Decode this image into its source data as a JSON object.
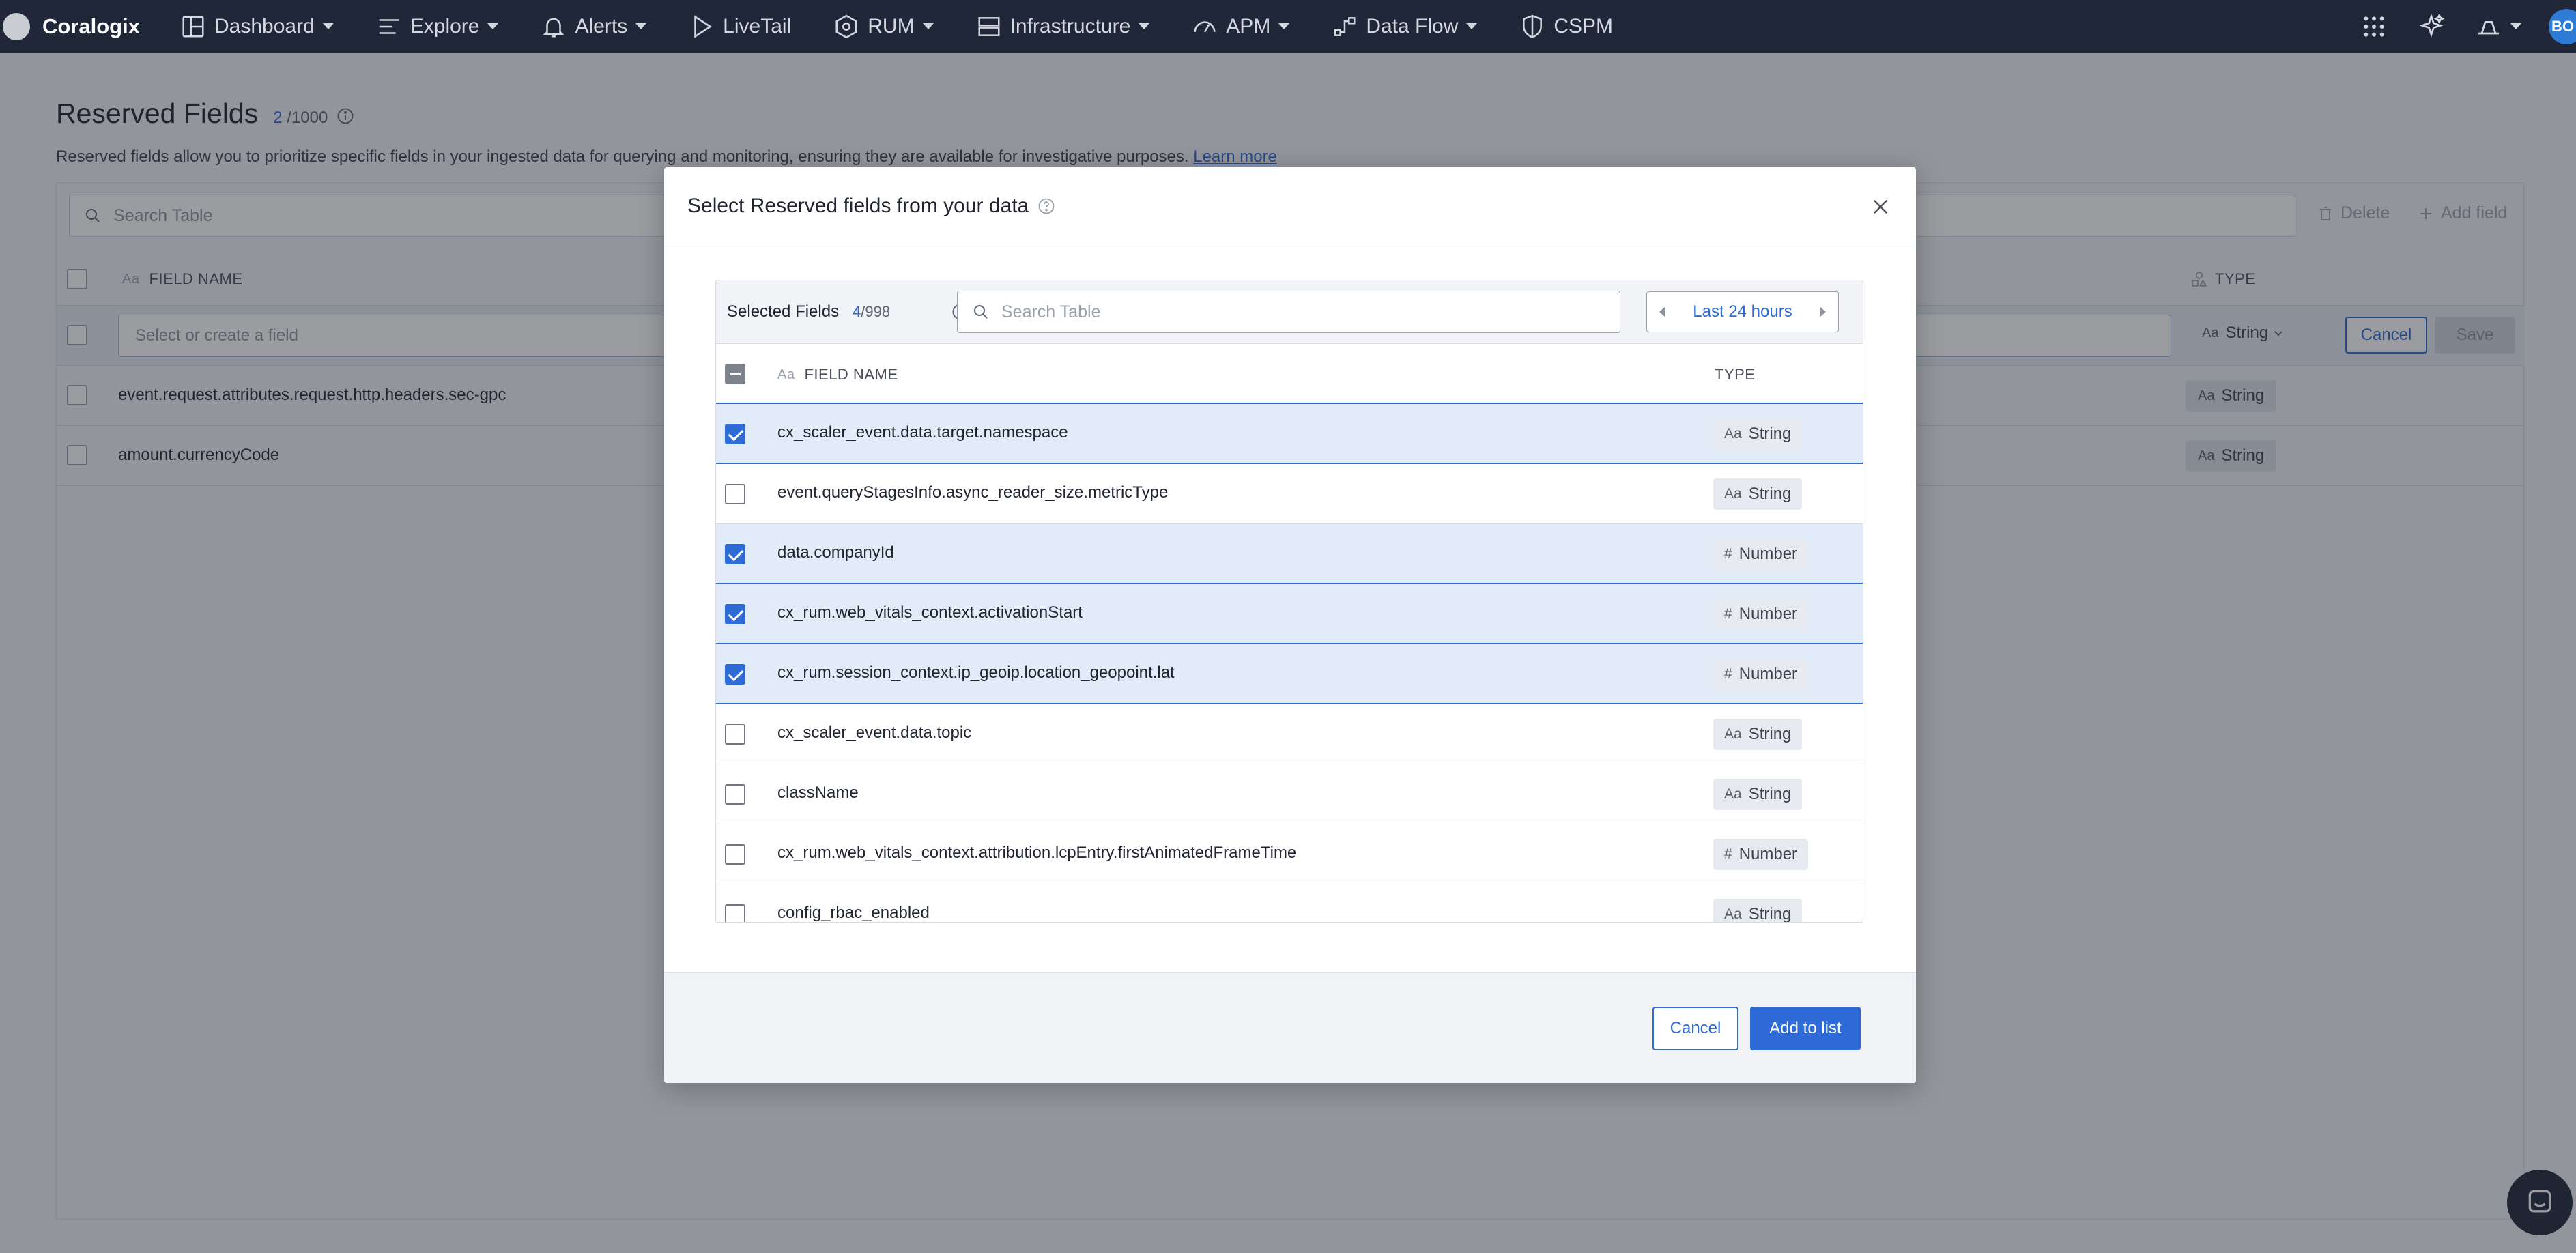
{
  "brand": {
    "name": "Coralogix"
  },
  "nav": {
    "items": [
      {
        "label": "Dashboard",
        "icon": "dashboard-icon",
        "has_caret": true
      },
      {
        "label": "Explore",
        "icon": "explore-icon",
        "has_caret": true
      },
      {
        "label": "Alerts",
        "icon": "bell-icon",
        "has_caret": true
      },
      {
        "label": "LiveTail",
        "icon": "play-icon",
        "has_caret": false
      },
      {
        "label": "RUM",
        "icon": "rum-icon",
        "has_caret": true
      },
      {
        "label": "Infrastructure",
        "icon": "server-icon",
        "has_caret": true
      },
      {
        "label": "APM",
        "icon": "gauge-icon",
        "has_caret": true
      },
      {
        "label": "Data Flow",
        "icon": "flow-icon",
        "has_caret": true
      },
      {
        "label": "CSPM",
        "icon": "shield-icon",
        "has_caret": false
      }
    ],
    "avatar_initials": "BO"
  },
  "page": {
    "title": "Reserved Fields",
    "count_used": "2",
    "count_total": "/1000",
    "description": "Reserved fields allow you to prioritize specific fields in your ingested data for querying and monitoring, ensuring they are available for investigative purposes.",
    "learn_more": "Learn more",
    "search_placeholder": "Search Table",
    "delete_label": "Delete",
    "add_field_label": "Add field",
    "col_field_name": "FIELD NAME",
    "col_type": "TYPE",
    "type_icon_glyph": "Aa",
    "edit_row": {
      "placeholder": "Select or create a field",
      "type": "String",
      "cancel": "Cancel",
      "save": "Save"
    },
    "rows": [
      {
        "field": "event.request.attributes.request.http.headers.sec-gpc",
        "type": "String"
      },
      {
        "field": "amount.currencyCode",
        "type": "String"
      }
    ]
  },
  "modal": {
    "title": "Select Reserved fields from your data",
    "selected_label": "Selected Fields",
    "selected_count": "4",
    "selected_total": "/998",
    "search_placeholder": "Search Table",
    "time_range": "Last 24 hours",
    "col_field_name": "FIELD NAME",
    "col_type": "TYPE",
    "rows": [
      {
        "field": "cx_scaler_event.data.target.namespace",
        "type": "String",
        "checked": true
      },
      {
        "field": "event.queryStagesInfo.async_reader_size.metricType",
        "type": "String",
        "checked": false
      },
      {
        "field": "data.companyId",
        "type": "Number",
        "checked": true
      },
      {
        "field": "cx_rum.web_vitals_context.activationStart",
        "type": "Number",
        "checked": true
      },
      {
        "field": "cx_rum.session_context.ip_geoip.location_geopoint.lat",
        "type": "Number",
        "checked": true
      },
      {
        "field": "cx_scaler_event.data.topic",
        "type": "String",
        "checked": false
      },
      {
        "field": "className",
        "type": "String",
        "checked": false
      },
      {
        "field": "cx_rum.web_vitals_context.attribution.lcpEntry.firstAnimatedFrameTime",
        "type": "Number",
        "checked": false
      },
      {
        "field": "config_rbac_enabled",
        "type": "String",
        "checked": false
      }
    ],
    "type_glyphs": {
      "String": "Aa",
      "Number": "#"
    },
    "cancel": "Cancel",
    "add": "Add to list"
  },
  "colors": {
    "accent": "#2e6bd6",
    "nav_bg": "#1f2739",
    "selected_row": "#e2ebf8"
  }
}
